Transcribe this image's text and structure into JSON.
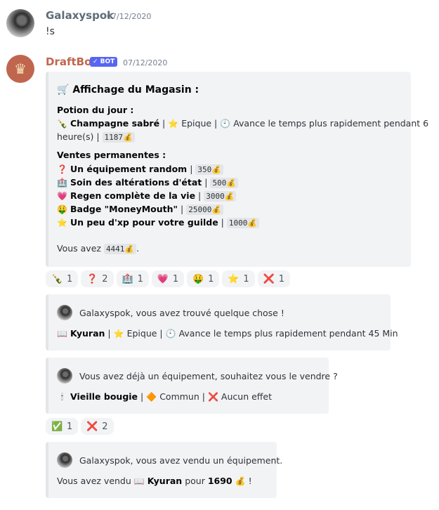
{
  "messages": [
    {
      "author": "Galaxyspok",
      "timestamp": "07/12/2020",
      "text": "!s"
    },
    {
      "author": "DraftBot",
      "bot_tag": "✓ BOT",
      "timestamp": "07/12/2020"
    }
  ],
  "shop": {
    "title_icon": "🛒",
    "title": "Affichage du Magasin :",
    "potion_heading": "Potion du jour :",
    "potion": {
      "icon": "🍾",
      "name": "Champagne sabré",
      "rarity_icon": "⭐",
      "rarity": "Epique",
      "effect_icon": "🕙",
      "effect": "Avance le temps plus rapidement pendant 6",
      "effect_cont": "heure(s)",
      "price": "1187💰"
    },
    "permanent_heading": "Ventes permanentes :",
    "items": [
      {
        "icon": "❓",
        "name": "Un équipement random",
        "price": "350💰"
      },
      {
        "icon": "🏥",
        "name": "Soin des altérations d'état",
        "price": "500💰"
      },
      {
        "icon": "💗",
        "name": "Regen complète de la vie",
        "price": "3000💰"
      },
      {
        "icon": "🤑",
        "name": "Badge \"MoneyMouth\"",
        "price": "25000💰"
      },
      {
        "icon": "⭐",
        "name": "Un peu d'xp pour votre guilde",
        "price": "1000💰"
      }
    ],
    "balance_prefix": "Vous avez",
    "balance": "4441💰",
    "balance_suffix": "."
  },
  "reactions1": [
    {
      "emoji": "🍾",
      "count": "1"
    },
    {
      "emoji": "❓",
      "count": "2"
    },
    {
      "emoji": "🏥",
      "count": "1"
    },
    {
      "emoji": "💗",
      "count": "1"
    },
    {
      "emoji": "🤑",
      "count": "1"
    },
    {
      "emoji": "⭐",
      "count": "1"
    },
    {
      "emoji": "❌",
      "count": "1"
    }
  ],
  "embed_found": {
    "header": "Galaxyspok, vous avez trouvé quelque chose !",
    "item_icon": "📖",
    "item": "Kyuran",
    "rarity_icon": "⭐",
    "rarity": "Epique",
    "effect_icon": "🕙",
    "effect": "Avance le temps plus rapidement pendant 45 Min"
  },
  "embed_sell": {
    "header": "Vous avez déjà un équipement, souhaitez vous le vendre ?",
    "item_icon": "🕯",
    "item": "Vieille bougie",
    "rarity_icon": "🔶",
    "rarity": "Commun",
    "effect_icon": "❌",
    "effect": "Aucun effet"
  },
  "reactions2": [
    {
      "emoji": "✅",
      "count": "1"
    },
    {
      "emoji": "❌",
      "count": "2"
    }
  ],
  "embed_sold": {
    "header": "Galaxyspok, vous avez vendu un équipement.",
    "prefix": "Vous avez vendu",
    "item_icon": "📖",
    "item": "Kyuran",
    "mid": "pour",
    "amount": "1690",
    "money_icon": "💰",
    "suffix": "!"
  }
}
